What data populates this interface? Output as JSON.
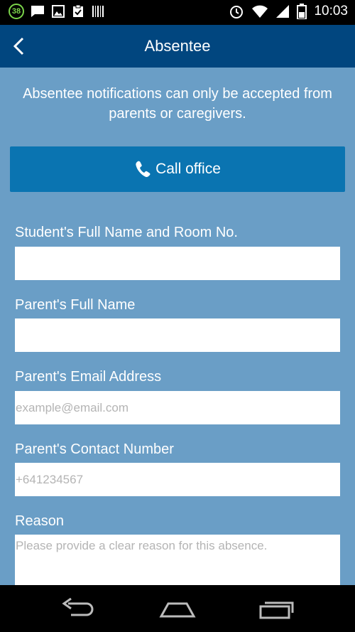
{
  "status_bar": {
    "notification_badge": "38",
    "time": "10:03",
    "left_icons": [
      "message-icon",
      "image-icon",
      "clipboard-icon",
      "barcode-icon"
    ],
    "right_icons": [
      "alarm-icon",
      "wifi-icon",
      "signal-icon",
      "battery-icon"
    ]
  },
  "app_bar": {
    "title": "Absentee",
    "background": "#01467f"
  },
  "notice": "Absentee notifications can only be accepted from parents or caregivers.",
  "call_button": {
    "label": "Call office",
    "color": "#0a74b1"
  },
  "form": {
    "student_name": {
      "label": "Student's Full Name and Room No.",
      "value": "",
      "placeholder": ""
    },
    "parent_name": {
      "label": "Parent's Full Name",
      "value": "",
      "placeholder": ""
    },
    "parent_email": {
      "label": "Parent's Email Address",
      "value": "",
      "placeholder": "example@email.com"
    },
    "parent_phone": {
      "label": "Parent's Contact Number",
      "value": "",
      "placeholder": "+641234567"
    },
    "reason": {
      "label": "Reason",
      "value": "",
      "placeholder": "Please provide a clear reason for this absence."
    }
  },
  "theme": {
    "page_background": "#6a9ec6"
  }
}
